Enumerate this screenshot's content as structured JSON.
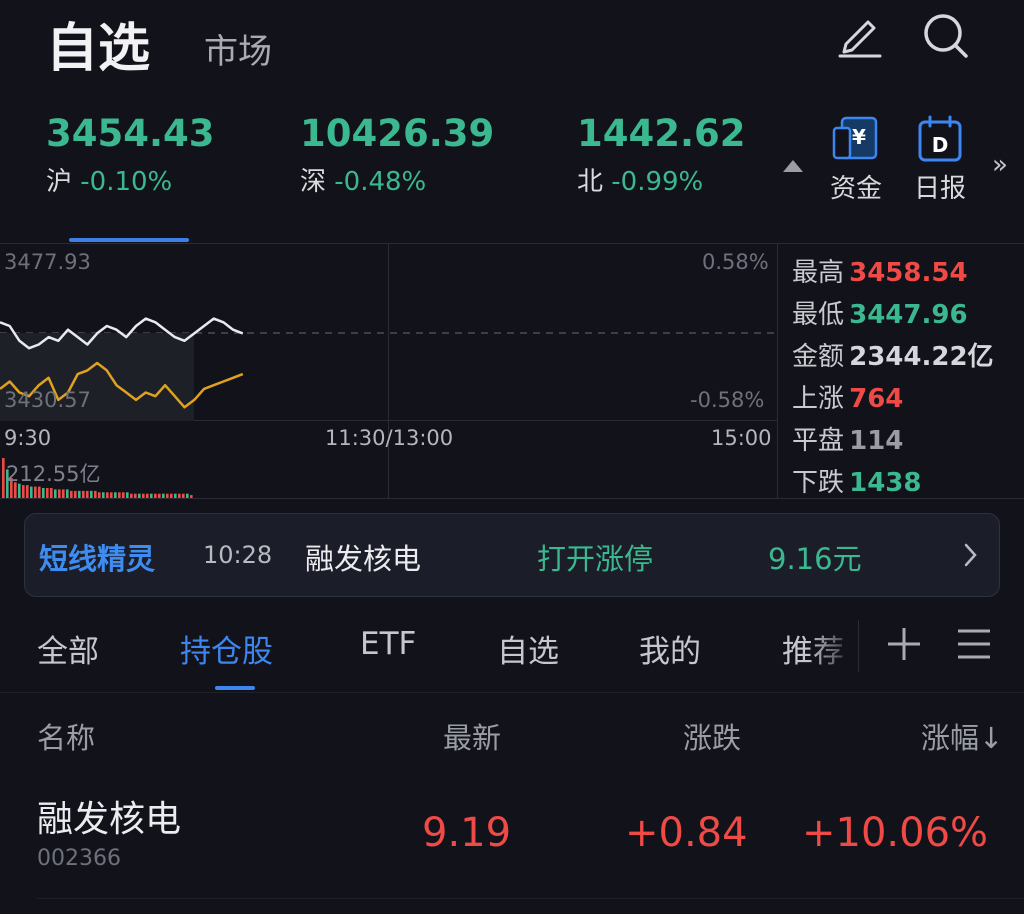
{
  "header": {
    "title": "自选",
    "market_tab": "市场"
  },
  "indices": [
    {
      "value": "3454.43",
      "name": "沪",
      "change": "-0.10%"
    },
    {
      "value": "10426.39",
      "name": "深",
      "change": "-0.48%"
    },
    {
      "value": "1442.62",
      "name": "北",
      "change": "-0.99%"
    }
  ],
  "quick_actions": [
    {
      "label": "资金",
      "icon": "yen-card-icon"
    },
    {
      "label": "日报",
      "icon": "calendar-d-icon"
    }
  ],
  "chart": {
    "top_price": "3477.93",
    "bottom_price": "3430.57",
    "top_pct": "0.58%",
    "bottom_pct": "-0.58%",
    "time_start": "9:30",
    "time_mid": "11:30/13:00",
    "time_end": "15:00",
    "volume": "212.55亿"
  },
  "chart_data": {
    "type": "line",
    "series": [
      {
        "values": [
          3457,
          3456,
          3452,
          3450,
          3451,
          3453,
          3452,
          3455,
          3453,
          3451,
          3454,
          3456,
          3455,
          3453,
          3456,
          3458,
          3457,
          3455,
          3453,
          3452,
          3454,
          3456,
          3458,
          3457,
          3455,
          3454
        ]
      },
      {
        "values": [
          3439,
          3441,
          3438,
          3437,
          3440,
          3442,
          3436,
          3438,
          3443,
          3444,
          3446,
          3444,
          3440,
          3438,
          3436,
          3438,
          3437,
          3440,
          3437,
          3434,
          3436,
          3439,
          3440,
          3441,
          3442,
          3443
        ]
      }
    ],
    "ylim": [
      3430.57,
      3477.93
    ],
    "volume_values": [
      28,
      20,
      14,
      11,
      10,
      9,
      9,
      8,
      8,
      8,
      7,
      7,
      7,
      6,
      6,
      6,
      6,
      5,
      5,
      5,
      5,
      5,
      5,
      5,
      4,
      4,
      4,
      4,
      4,
      4,
      4,
      4,
      3,
      3,
      3,
      3,
      3,
      3,
      3,
      3,
      3,
      3,
      3,
      3,
      3,
      3,
      3,
      2
    ]
  },
  "stats": [
    {
      "name": "最高",
      "value": "3458.54",
      "color": "#f04a46"
    },
    {
      "name": "最低",
      "value": "3447.96",
      "color": "#3bb88f"
    },
    {
      "name": "金额",
      "value": "2344.22亿",
      "color": "#d6d7dc"
    },
    {
      "name": "上涨",
      "value": "764",
      "color": "#f04a46"
    },
    {
      "name": "平盘",
      "value": "114",
      "color": "#9a9ca6"
    },
    {
      "name": "下跌",
      "value": "1438",
      "color": "#3bb88f"
    }
  ],
  "banner": {
    "title": "短线精灵",
    "time": "10:28",
    "stock": "融发核电",
    "event": "打开涨停",
    "price": "9.16元"
  },
  "tabs": [
    "全部",
    "持仓股",
    "ETF",
    "自选",
    "我的",
    "推荐"
  ],
  "active_tab": "持仓股",
  "table": {
    "headers": {
      "name": "名称",
      "latest": "最新",
      "change": "涨跌",
      "pct": "涨幅↓"
    },
    "rows": [
      {
        "name": "融发核电",
        "code": "002366",
        "latest": "9.19",
        "change": "+0.84",
        "pct": "+10.06%"
      }
    ]
  },
  "colors": {
    "up": "#f04a46",
    "down": "#3bb88f",
    "accent": "#3d86f0",
    "bg": "#12131a"
  }
}
